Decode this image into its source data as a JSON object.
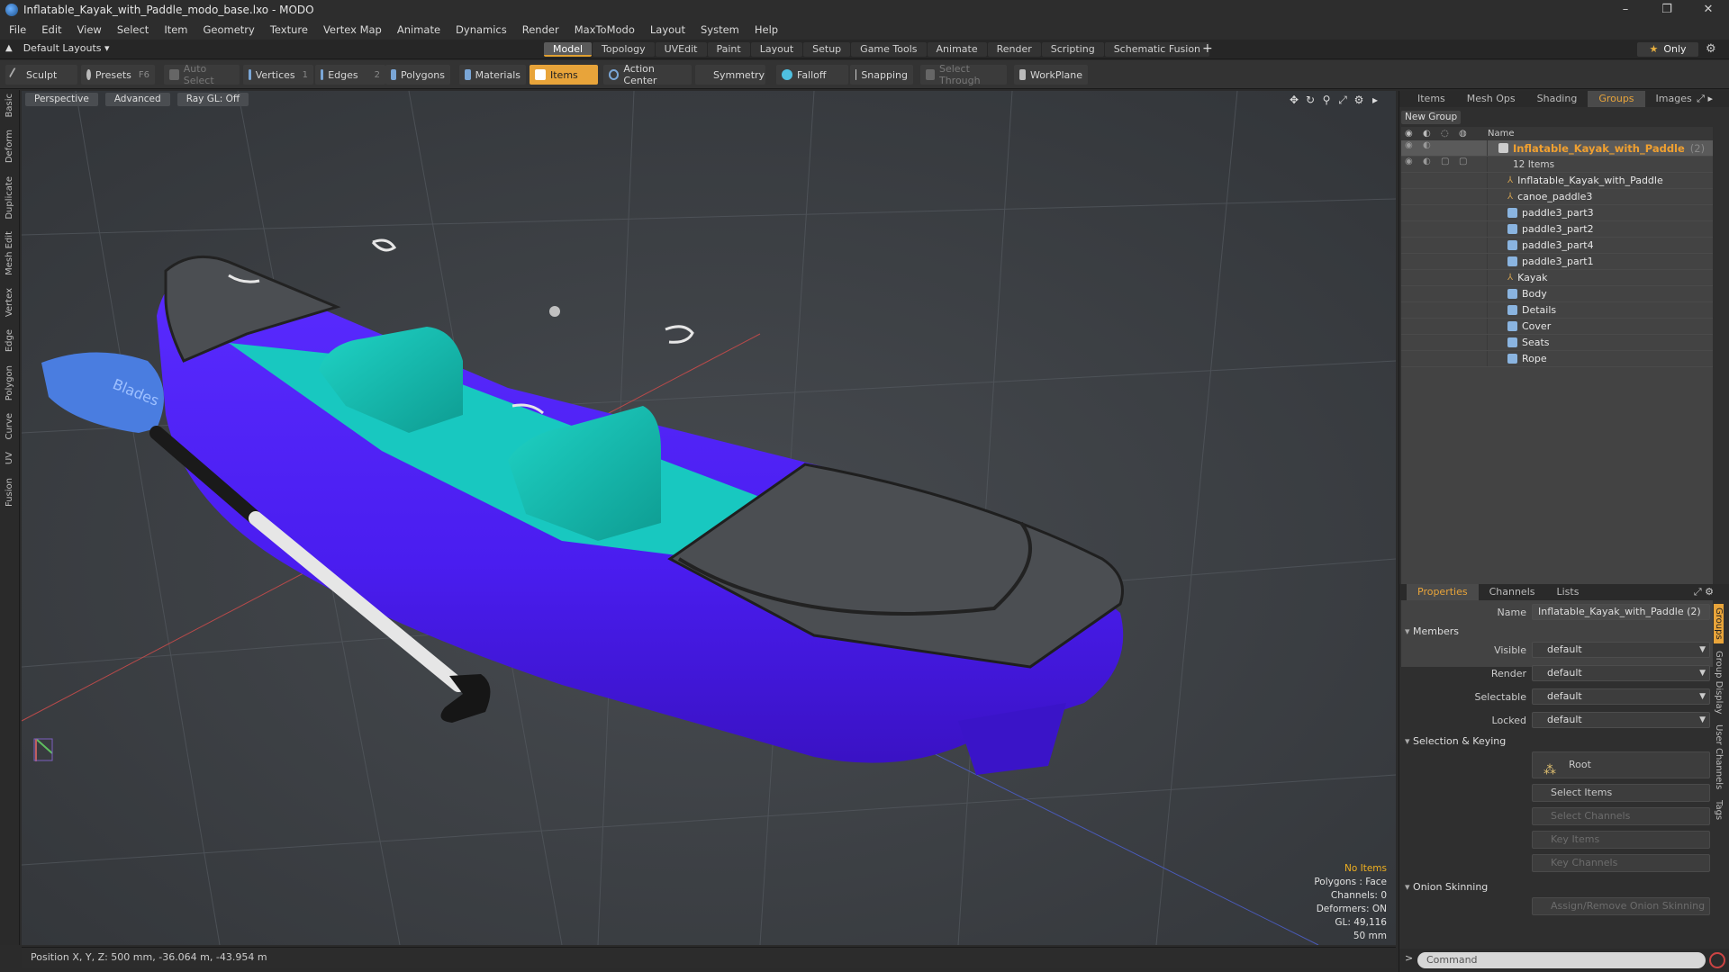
{
  "window": {
    "title": "Inflatable_Kayak_with_Paddle_modo_base.lxo - MODO",
    "min": "–",
    "max": "❐",
    "close": "✕"
  },
  "menu": [
    "File",
    "Edit",
    "View",
    "Select",
    "Item",
    "Geometry",
    "Texture",
    "Vertex Map",
    "Animate",
    "Dynamics",
    "Render",
    "MaxToModo",
    "Layout",
    "System",
    "Help"
  ],
  "layoutbar": {
    "layout": "Default Layouts ▾",
    "tabs": [
      "Model",
      "Topology",
      "UVEdit",
      "Paint",
      "Layout",
      "Setup",
      "Game Tools",
      "Animate",
      "Render",
      "Scripting",
      "Schematic Fusion"
    ],
    "active_tab": "Model",
    "plus": "+",
    "only": "Only",
    "star": "★"
  },
  "toolbar": {
    "sculpt": "Sculpt",
    "presets": "Presets",
    "presets_key": "F6",
    "auto_select": "Auto Select",
    "vertices": "Vertices",
    "vertices_key": "1",
    "edges": "Edges",
    "edges_key": "2",
    "polygons": "Polygons",
    "materials": "Materials",
    "items": "Items",
    "action_center": "Action Center",
    "symmetry": "Symmetry",
    "falloff": "Falloff",
    "snapping": "Snapping",
    "select_through": "Select Through",
    "workplane": "WorkPlane"
  },
  "lefttabs": [
    "Basic",
    "Deform",
    "Duplicate",
    "Mesh Edit",
    "Vertex",
    "Edge",
    "Polygon",
    "Curve",
    "UV",
    "Fusion"
  ],
  "viewport": {
    "perspective": "Perspective",
    "advanced": "Advanced",
    "raygl": "Ray GL: Off",
    "info": {
      "no_items": "No Items",
      "polygons": "Polygons : Face",
      "channels": "Channels: 0",
      "deformers": "Deformers: ON",
      "gl": "GL: 49,116",
      "scale": "50 mm"
    },
    "paddle_logo": "Blades"
  },
  "status": {
    "position": "Position X, Y, Z:  500 mm, -36.064 m, -43.954 m"
  },
  "outliner": {
    "tabs": [
      "Items",
      "Mesh Ops",
      "Shading",
      "Groups",
      "Images"
    ],
    "active_tab": "Groups",
    "new_group": "New Group",
    "col_name": "Name",
    "group_name": "Inflatable_Kayak_with_Paddle",
    "group_count": "(2)",
    "item_count": "12 Items",
    "items": [
      {
        "name": "Inflatable_Kayak_with_Paddle",
        "type": "locator"
      },
      {
        "name": "canoe_paddle3",
        "type": "locator"
      },
      {
        "name": "paddle3_part3",
        "type": "mesh"
      },
      {
        "name": "paddle3_part2",
        "type": "mesh"
      },
      {
        "name": "paddle3_part4",
        "type": "mesh"
      },
      {
        "name": "paddle3_part1",
        "type": "mesh"
      },
      {
        "name": "Kayak",
        "type": "locator"
      },
      {
        "name": "Body",
        "type": "mesh"
      },
      {
        "name": "Details",
        "type": "mesh"
      },
      {
        "name": "Cover",
        "type": "mesh"
      },
      {
        "name": "Seats",
        "type": "mesh"
      },
      {
        "name": "Rope",
        "type": "mesh"
      }
    ]
  },
  "properties": {
    "tabs": [
      "Properties",
      "Channels",
      "Lists"
    ],
    "active_tab": "Properties",
    "name_label": "Name",
    "name_value": "Inflatable_Kayak_with_Paddle (2)",
    "members": "Members",
    "visible_label": "Visible",
    "visible": "default",
    "render_label": "Render",
    "render": "default",
    "selectable_label": "Selectable",
    "selectable": "default",
    "locked_label": "Locked",
    "locked": "default",
    "sel_keying": "Selection & Keying",
    "root": "Root",
    "select_items": "Select Items",
    "select_channels": "Select Channels",
    "key_items": "Key Items",
    "key_channels": "Key Channels",
    "onion": "Onion Skinning",
    "assign_onion": "Assign/Remove Onion Skinning",
    "vtabs": [
      "Groups",
      "Group Display",
      "User Channels",
      "Tags"
    ]
  },
  "command": {
    "placeholder": "Command"
  }
}
